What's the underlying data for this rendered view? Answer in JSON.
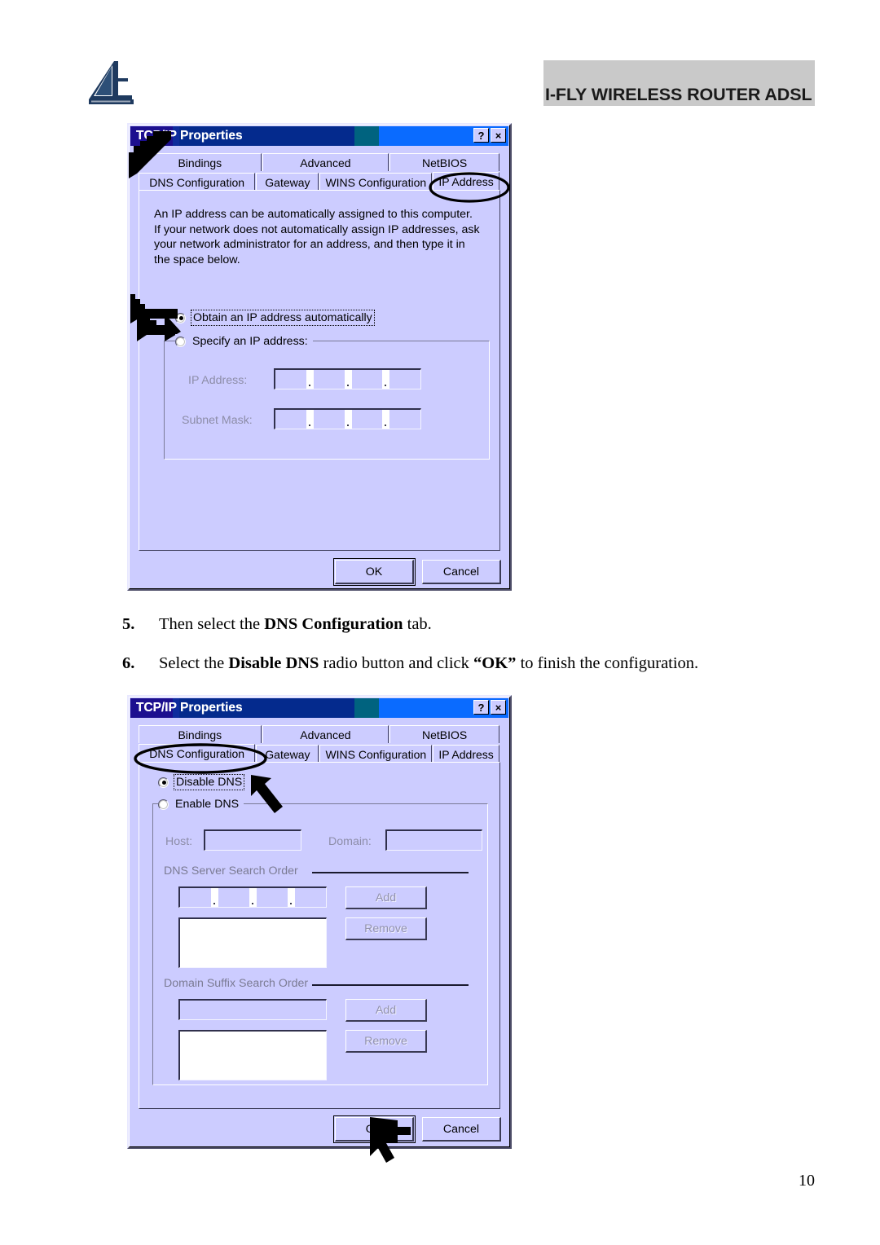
{
  "header": {
    "logo_name": "atlantis-land-logo",
    "banner_title": "I-FLY WIRELESS ROUTER ADSL",
    "banner_bg": "#c9c9c9"
  },
  "colors": {
    "dialog_face": "#ccccff",
    "titlebar_start": "#1c0f8f",
    "titlebar_mid": "#00637f",
    "titlebar_end": "#0a6bff",
    "disabled_text": "#8d8da8",
    "annotation": "#000000"
  },
  "dialog_ip": {
    "title": "TCP/IP Properties",
    "help_button": "?",
    "close_button": "×",
    "tabs_row1": [
      "Bindings",
      "Advanced",
      "NetBIOS"
    ],
    "tabs_row2": [
      "DNS Configuration",
      "Gateway",
      "WINS Configuration",
      "IP Address"
    ],
    "active_tab": "IP Address",
    "circled_tab": "IP Address",
    "description": "An IP address can be automatically assigned to this computer.\nIf your network does not automatically assign IP addresses, ask\nyour network administrator for an address, and then type it in\nthe space below.",
    "radio_obtain": "Obtain an IP address automatically",
    "radio_obtain_selected": true,
    "radio_specify": "Specify an IP address:",
    "radio_specify_selected": false,
    "label_ip_address": "IP Address:",
    "label_subnet_mask": "Subnet Mask:",
    "ip_address_value": "",
    "subnet_mask_value": "",
    "ok_label": "OK",
    "cancel_label": "Cancel",
    "arrow_target": "radio-obtain-automatically"
  },
  "steps": [
    {
      "number": "5.",
      "parts": [
        {
          "text": "Then select the ",
          "bold": false
        },
        {
          "text": "DNS Configuration",
          "bold": true
        },
        {
          "text": " tab.",
          "bold": false
        }
      ]
    },
    {
      "number": "6.",
      "parts": [
        {
          "text": "Select the ",
          "bold": false
        },
        {
          "text": "Disable DNS",
          "bold": true
        },
        {
          "text": " radio button and click ",
          "bold": false
        },
        {
          "text": "“OK”",
          "bold": true
        },
        {
          "text": " to finish the configuration.",
          "bold": false
        }
      ]
    }
  ],
  "dialog_dns": {
    "title": "TCP/IP Properties",
    "help_button": "?",
    "close_button": "×",
    "tabs_row1": [
      "Bindings",
      "Advanced",
      "NetBIOS"
    ],
    "tabs_row2": [
      "DNS Configuration",
      "Gateway",
      "WINS Configuration",
      "IP Address"
    ],
    "active_tab": "DNS Configuration",
    "circled_tab": "DNS Configuration",
    "radio_disable": "Disable DNS",
    "radio_disable_selected": true,
    "radio_enable": "Enable DNS",
    "radio_enable_selected": false,
    "label_host": "Host:",
    "host_value": "",
    "label_domain": "Domain:",
    "domain_value": "",
    "group_dns_order": "DNS Server Search Order",
    "dns_order_value": "",
    "dns_order_list": [],
    "dns_add_label": "Add",
    "dns_remove_label": "Remove",
    "group_suffix_order": "Domain Suffix Search Order",
    "suffix_order_value": "",
    "suffix_order_list": [],
    "suffix_add_label": "Add",
    "suffix_remove_label": "Remove",
    "ok_label": "OK",
    "cancel_label": "Cancel",
    "arrow_targets": [
      "radio-disable-dns",
      "ok-button"
    ]
  },
  "footer": {
    "page_number": "10"
  }
}
